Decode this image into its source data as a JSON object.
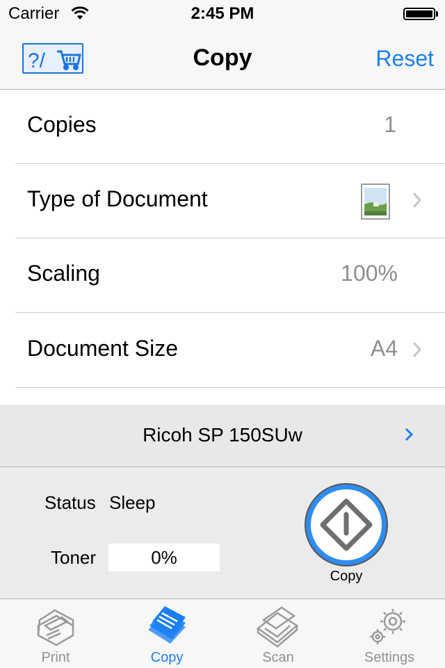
{
  "status_bar": {
    "carrier": "Carrier",
    "time": "2:45 PM"
  },
  "nav": {
    "help_button_text": "?/",
    "title": "Copy",
    "reset_label": "Reset"
  },
  "settings": {
    "copies": {
      "label": "Copies",
      "value": "1"
    },
    "document_type": {
      "label": "Type of Document",
      "icon": "photo-document-icon"
    },
    "scaling": {
      "label": "Scaling",
      "value": "100%"
    },
    "document_size": {
      "label": "Document Size",
      "value": "A4"
    }
  },
  "printer": {
    "name": "Ricoh SP 150SUw"
  },
  "status": {
    "status_label": "Status",
    "status_value": "Sleep",
    "toner_label": "Toner",
    "toner_value": "0%"
  },
  "copy_button": {
    "label": "Copy"
  },
  "tabs": [
    {
      "label": "Print",
      "icon": "printer-icon",
      "active": false
    },
    {
      "label": "Copy",
      "icon": "copy-documents-icon",
      "active": true
    },
    {
      "label": "Scan",
      "icon": "scanner-icon",
      "active": false
    },
    {
      "label": "Settings",
      "icon": "gears-icon",
      "active": false
    }
  ],
  "colors": {
    "accent": "#1a7ff5",
    "secondary_text": "#8e8e93",
    "tab_inactive": "#929292"
  }
}
